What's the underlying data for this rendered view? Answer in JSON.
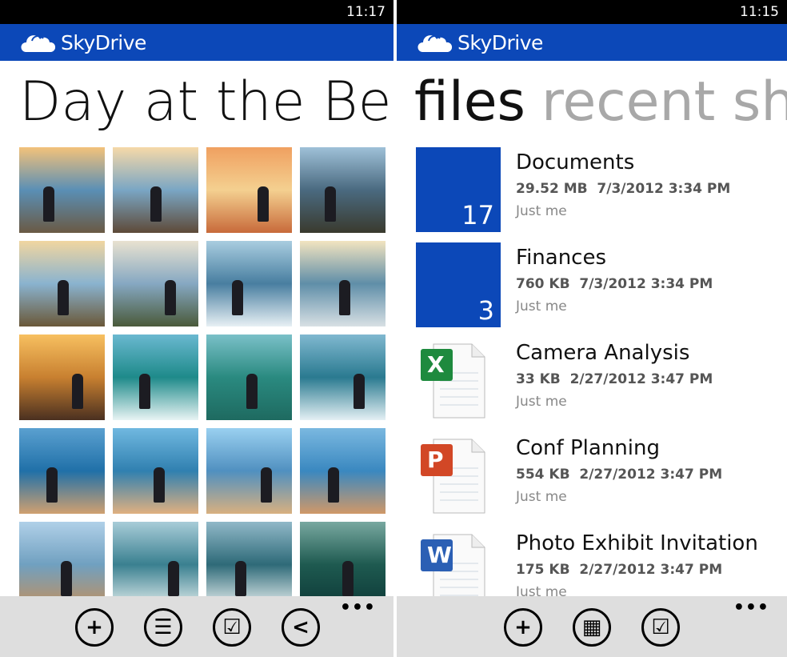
{
  "left": {
    "status_time": "11:17",
    "app_name": "SkyDrive",
    "title": "Day at the Beach",
    "photo_count": 20,
    "appbar": [
      {
        "icon": "add-icon",
        "glyph": "+"
      },
      {
        "icon": "list-icon",
        "glyph": "☰"
      },
      {
        "icon": "select-icon",
        "glyph": "☑"
      },
      {
        "icon": "share-icon",
        "glyph": "<"
      }
    ],
    "more": "•••"
  },
  "right": {
    "status_time": "11:15",
    "app_name": "SkyDrive",
    "pivot": {
      "active": "files",
      "inactive": "recent sha"
    },
    "files": [
      {
        "name": "Documents",
        "size": "29.52 MB",
        "date": "7/3/2012 3:34 PM",
        "sharing": "Just me",
        "type": "folder",
        "count": "17"
      },
      {
        "name": "Finances",
        "size": "760 KB",
        "date": "7/3/2012 3:34 PM",
        "sharing": "Just me",
        "type": "folder",
        "count": "3"
      },
      {
        "name": "Camera Analysis",
        "size": "33 KB",
        "date": "2/27/2012 3:47 PM",
        "sharing": "Just me",
        "type": "excel",
        "badge": "X"
      },
      {
        "name": "Conf Planning",
        "size": "554 KB",
        "date": "2/27/2012 3:47 PM",
        "sharing": "Just me",
        "type": "powerpoint",
        "badge": "P"
      },
      {
        "name": "Photo Exhibit Invitation",
        "size": "175 KB",
        "date": "2/27/2012 3:47 PM",
        "sharing": "Just me",
        "type": "word",
        "badge": "W"
      }
    ],
    "appbar": [
      {
        "icon": "add-icon",
        "glyph": "+"
      },
      {
        "icon": "grid-view-icon",
        "glyph": "▦"
      },
      {
        "icon": "select-icon",
        "glyph": "☑"
      }
    ],
    "more": "•••"
  },
  "colors": {
    "brand": "#0c48b8",
    "appbar": "#dedede",
    "excel": "#1e8a3e",
    "powerpoint": "#d24726",
    "word": "#2b5fb4"
  }
}
